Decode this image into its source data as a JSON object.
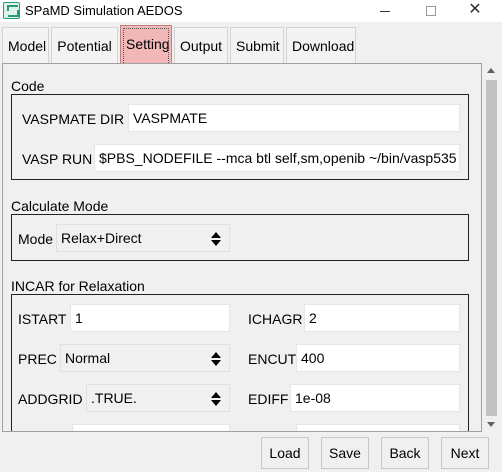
{
  "window": {
    "title": "SPaMD Simulation AEDOS",
    "close_glyph": "✕"
  },
  "tabs": [
    {
      "label": "Model"
    },
    {
      "label": "Potential"
    },
    {
      "label": "Setting",
      "active": true
    },
    {
      "label": "Output"
    },
    {
      "label": "Submit"
    },
    {
      "label": "Download"
    }
  ],
  "code": {
    "title": "Code",
    "vaspmate_dir_label": "VASPMATE DIR",
    "vaspmate_dir_value": "VASPMATE",
    "vasp_run_label": "VASP RUN",
    "vasp_run_value": "$PBS_NODEFILE --mca btl self,sm,openib ~/bin/vasp535"
  },
  "calculate_mode": {
    "title": "Calculate Mode",
    "mode_label": "Mode",
    "mode_value": "Relax+Direct"
  },
  "incar": {
    "title": "INCAR for Relaxation",
    "istart_label": "ISTART",
    "istart_value": "1",
    "ichagr_label": "ICHAGR",
    "ichagr_value": "2",
    "prec_label": "PREC",
    "prec_value": "Normal",
    "encut_label": "ENCUT",
    "encut_value": "400",
    "addgrid_label": "ADDGRID",
    "addgrid_value": ".TRUE.",
    "ediff_label": "EDIFF",
    "ediff_value": "1e-08"
  },
  "footer": {
    "load_label": "Load",
    "save_label": "Save",
    "back_label": "Back",
    "next_label": "Next"
  },
  "colors": {
    "active_tab": "#f2b8b8",
    "icon_accent": "#2a9a7c"
  }
}
